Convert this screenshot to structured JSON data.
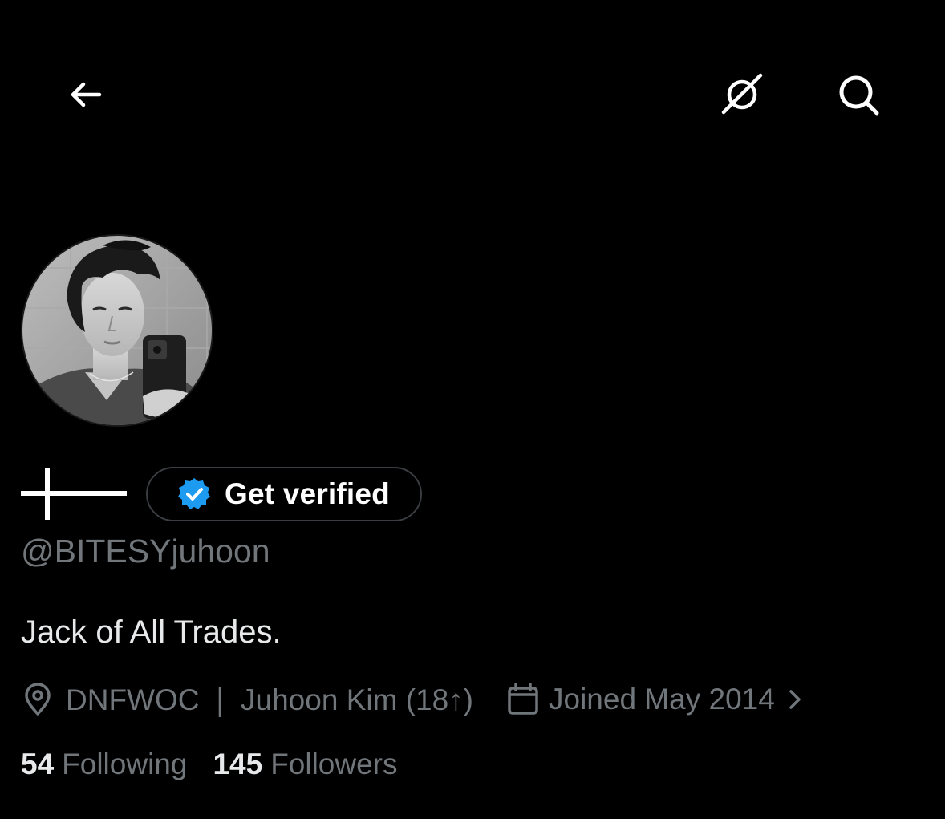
{
  "header": {
    "back_icon": "arrow-left-icon",
    "grok_icon": "grok-icon",
    "search_icon": "search-icon"
  },
  "profile": {
    "avatar_icon": "profile-photo",
    "name_glyph": "┼—",
    "get_verified_label": "Get verified",
    "handle": "@BITESYjuhoon",
    "bio": "Jack of All Trades.",
    "location": "DNFWOC ❘ Juhoon Kim (18↑)",
    "joined": "Joined May 2014",
    "following_count": "54",
    "following_label": "Following",
    "followers_count": "145",
    "followers_label": "Followers"
  },
  "colors": {
    "background": "#000000",
    "primary_text": "#e7e9ea",
    "secondary_text": "#71767b",
    "verified_blue": "#1d9bf0",
    "pill_border": "#3a3d41"
  }
}
